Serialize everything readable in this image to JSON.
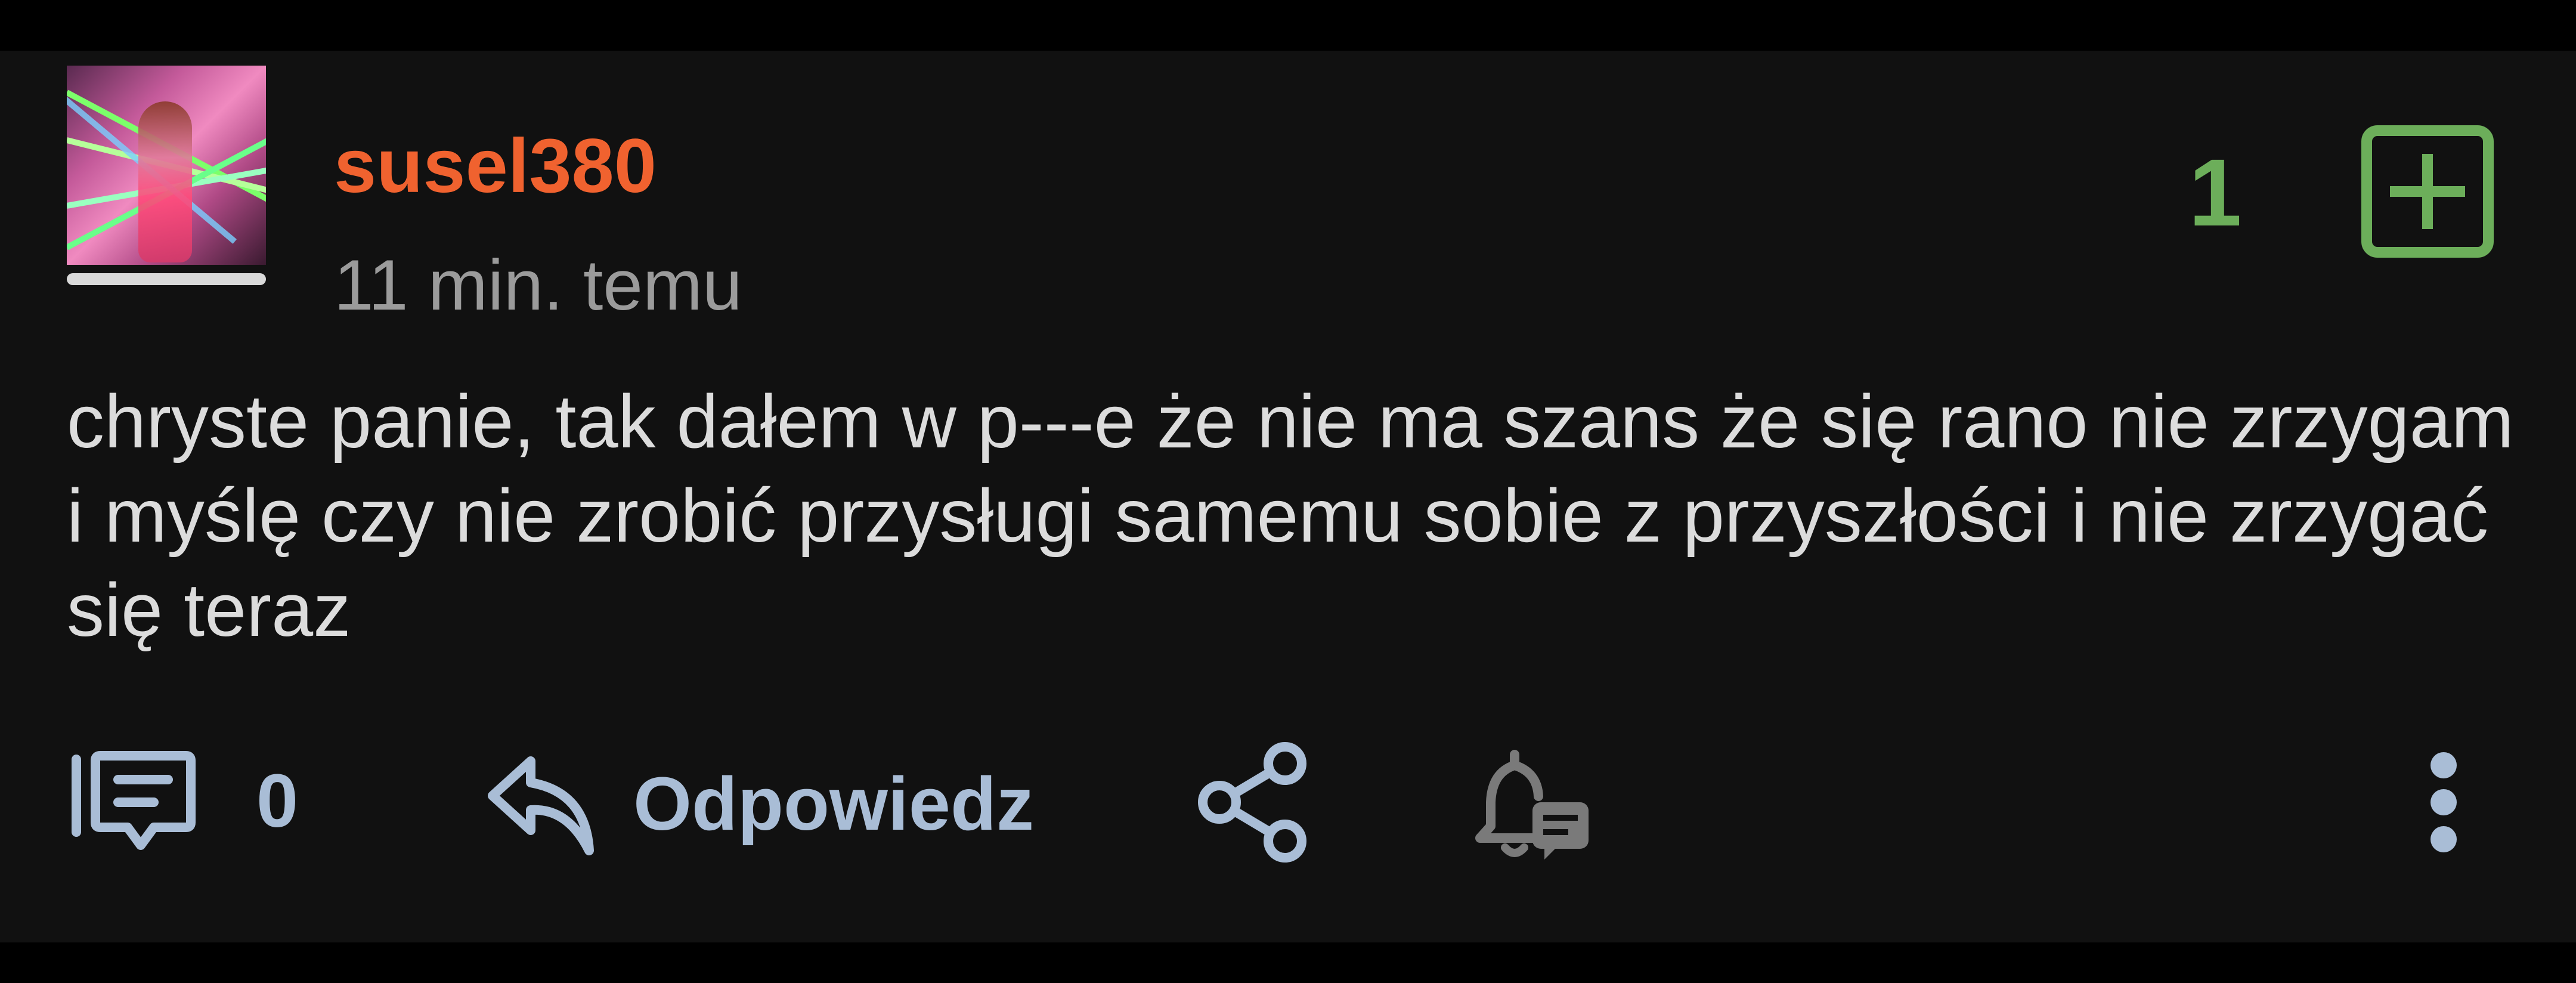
{
  "post": {
    "author": "susel380",
    "timestamp": "11 min. temu",
    "votes": "1",
    "body": "chryste panie, tak dałem w p---e że nie ma szans że się rano nie zrzygam i myślę czy nie zrobić przysługi samemu sobie z przyszłości i nie zrzygać się teraz"
  },
  "actions": {
    "comments_count": "0",
    "reply_label": "Odpowiedz"
  },
  "icons": {
    "comments": "comments-icon",
    "reply": "reply-icon",
    "share": "share-icon",
    "notify": "bell-comment-icon",
    "more": "more-vertical-icon",
    "plus": "plus-square-icon"
  },
  "colors": {
    "author": "#f0622f",
    "vote": "#6cae5a",
    "action": "#a9bdd6",
    "text": "#dcdcdc",
    "muted": "#9b9b9b",
    "background": "#111111"
  }
}
